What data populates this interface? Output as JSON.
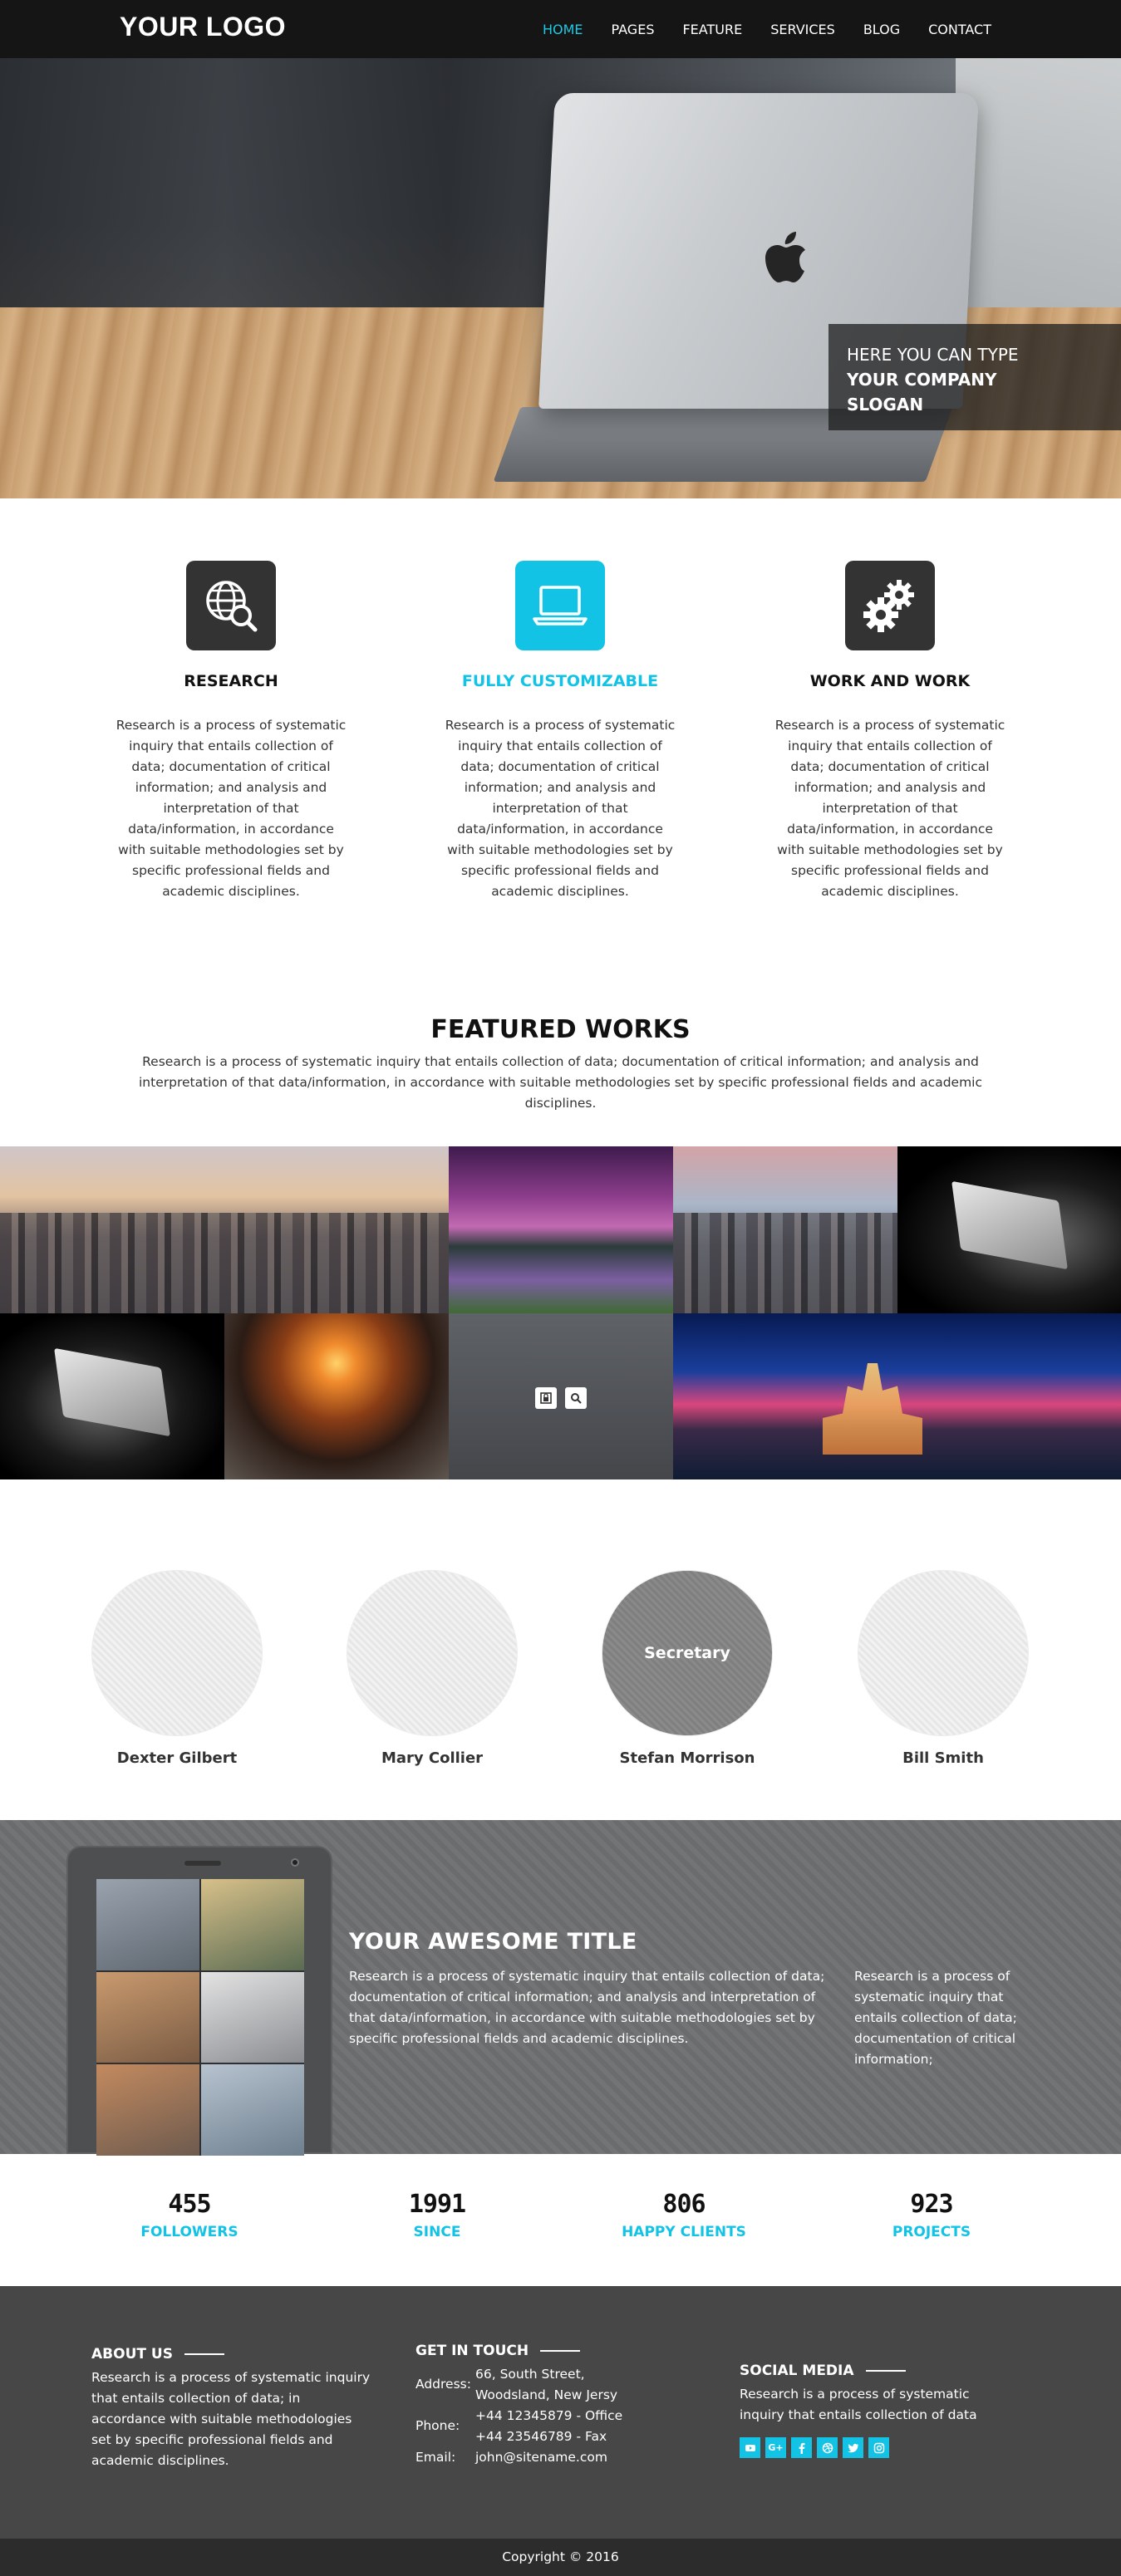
{
  "brand": {
    "logo": "YOUR LOGO",
    "accent": "#12c3e6"
  },
  "nav": {
    "items": [
      "HOME",
      "PAGES",
      "FEATURE",
      "SERVICES",
      "BLOG",
      "CONTACT"
    ],
    "active": "HOME"
  },
  "hero": {
    "slogan_line1": "HERE YOU CAN TYPE",
    "slogan_line2": "YOUR COMPANY",
    "slogan_line3": "SLOGAN"
  },
  "features": [
    {
      "icon": "globe-search-icon",
      "title": "RESEARCH",
      "text": "Research is a process of systematic inquiry that entails collection of data; documentation of critical information; and analysis and interpretation of that data/information, in accordance with suitable methodologies set by specific professional fields and academic disciplines."
    },
    {
      "icon": "laptop-icon",
      "title": "FULLY CUSTOMIZABLE",
      "text": "Research is a process of systematic inquiry that entails collection of data; documentation of critical information; and analysis and interpretation of that data/information, in accordance with suitable methodologies set by specific professional fields and academic disciplines."
    },
    {
      "icon": "gears-icon",
      "title": "WORK AND WORK",
      "text": "Research is a process of systematic inquiry that entails collection of data; documentation of critical information; and analysis and interpretation of that data/information, in accordance with suitable methodologies set by specific professional fields and academic disciplines."
    }
  ],
  "featured_works": {
    "title": "FEATURED WORKS",
    "description": "Research is a process of systematic inquiry that entails collection of data; documentation of critical information; and analysis and interpretation of that data/information, in accordance with suitable methodologies set by specific professional fields and academic disciplines."
  },
  "team": [
    {
      "name": "Dexter Gilbert",
      "role": ""
    },
    {
      "name": "Mary Collier",
      "role": ""
    },
    {
      "name": "Stefan Morrison",
      "role": "Secretary"
    },
    {
      "name": "Bill Smith",
      "role": ""
    }
  ],
  "awesome": {
    "title": "YOUR AWESOME TITLE",
    "text1": "Research is a process of systematic inquiry that entails collection of data; documentation of critical information; and analysis and interpretation of that data/information, in accordance with suitable methodologies set by specific professional fields and academic disciplines.",
    "text2": "Research is a process of systematic inquiry that entails collection of data; documentation of critical information;"
  },
  "stats": [
    {
      "value": "455",
      "label": "FOLLOWERS"
    },
    {
      "value": "1991",
      "label": "SINCE"
    },
    {
      "value": "806",
      "label": "HAPPY CLIENTS"
    },
    {
      "value": "923",
      "label": "PROJECTS"
    }
  ],
  "footer": {
    "about_title": "ABOUT US",
    "about_text": "Research is a process of systematic inquiry that entails collection of data; in accordance with suitable methodologies set by specific professional fields and academic disciplines.",
    "contact_title": "GET IN TOUCH",
    "address_label": "Address:",
    "address_line1": "66, South Street,",
    "address_line2": "Woodsland, New Jersy",
    "phone_label": "Phone:",
    "phone_office": "+44 12345879 - Office",
    "phone_fax": "+44 23546789 - Fax",
    "email_label": "Email:",
    "email": "john@sitename.com",
    "social_title": "SOCIAL MEDIA",
    "social_text": "Research is a process of systematic inquiry that entails collection of data",
    "social_icons": [
      "youtube-icon",
      "google-plus-icon",
      "facebook-icon",
      "dribbble-icon",
      "twitter-icon",
      "instagram-icon"
    ]
  },
  "copyright": "Copyright © 2016"
}
